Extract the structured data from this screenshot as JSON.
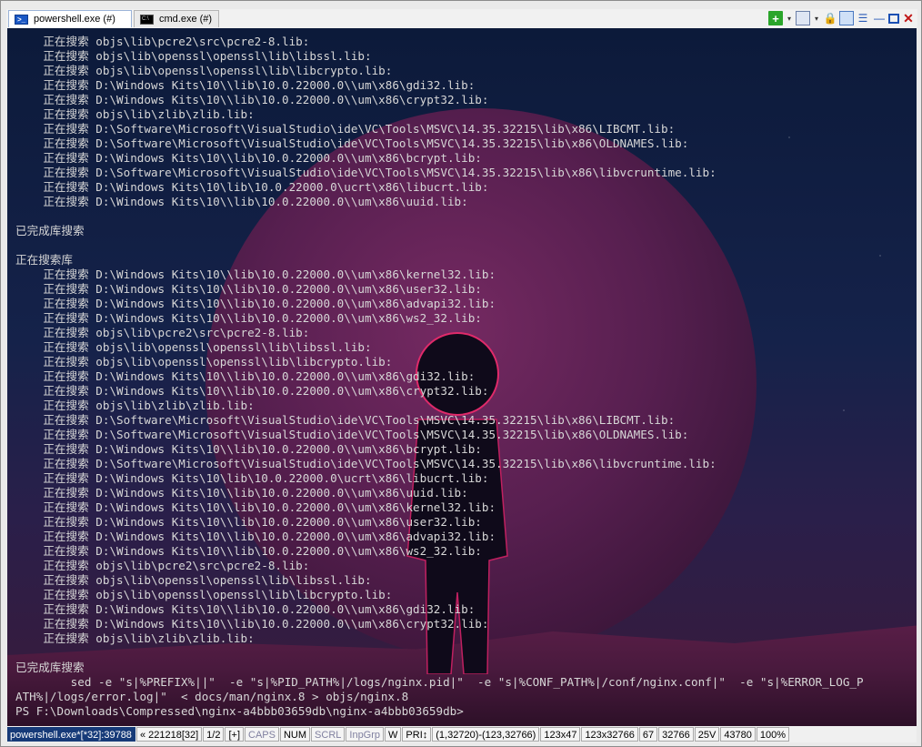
{
  "tabs": [
    {
      "label": "powershell.exe (#)",
      "active": true,
      "icon": "powershell-icon"
    },
    {
      "label": "cmd.exe (#)",
      "active": false,
      "icon": "cmd-icon"
    }
  ],
  "toolbar": {
    "add": "+",
    "dropdown": "▾",
    "view": "▯",
    "lock": "🔒",
    "pane": "◧",
    "list": "☰",
    "minimize": "—",
    "close": "✕"
  },
  "console_lines": [
    "    正在搜索 objs\\lib\\pcre2\\src\\pcre2-8.lib:",
    "    正在搜索 objs\\lib\\openssl\\openssl\\lib\\libssl.lib:",
    "    正在搜索 objs\\lib\\openssl\\openssl\\lib\\libcrypto.lib:",
    "    正在搜索 D:\\Windows Kits\\10\\\\lib\\10.0.22000.0\\\\um\\x86\\gdi32.lib:",
    "    正在搜索 D:\\Windows Kits\\10\\\\lib\\10.0.22000.0\\\\um\\x86\\crypt32.lib:",
    "    正在搜索 objs\\lib\\zlib\\zlib.lib:",
    "    正在搜索 D:\\Software\\Microsoft\\VisualStudio\\ide\\VC\\Tools\\MSVC\\14.35.32215\\lib\\x86\\LIBCMT.lib:",
    "    正在搜索 D:\\Software\\Microsoft\\VisualStudio\\ide\\VC\\Tools\\MSVC\\14.35.32215\\lib\\x86\\OLDNAMES.lib:",
    "    正在搜索 D:\\Windows Kits\\10\\\\lib\\10.0.22000.0\\\\um\\x86\\bcrypt.lib:",
    "    正在搜索 D:\\Software\\Microsoft\\VisualStudio\\ide\\VC\\Tools\\MSVC\\14.35.32215\\lib\\x86\\libvcruntime.lib:",
    "    正在搜索 D:\\Windows Kits\\10\\lib\\10.0.22000.0\\ucrt\\x86\\libucrt.lib:",
    "    正在搜索 D:\\Windows Kits\\10\\\\lib\\10.0.22000.0\\\\um\\x86\\uuid.lib:",
    "",
    "已完成库搜索",
    "",
    "正在搜索库",
    "    正在搜索 D:\\Windows Kits\\10\\\\lib\\10.0.22000.0\\\\um\\x86\\kernel32.lib:",
    "    正在搜索 D:\\Windows Kits\\10\\\\lib\\10.0.22000.0\\\\um\\x86\\user32.lib:",
    "    正在搜索 D:\\Windows Kits\\10\\\\lib\\10.0.22000.0\\\\um\\x86\\advapi32.lib:",
    "    正在搜索 D:\\Windows Kits\\10\\\\lib\\10.0.22000.0\\\\um\\x86\\ws2_32.lib:",
    "    正在搜索 objs\\lib\\pcre2\\src\\pcre2-8.lib:",
    "    正在搜索 objs\\lib\\openssl\\openssl\\lib\\libssl.lib:",
    "    正在搜索 objs\\lib\\openssl\\openssl\\lib\\libcrypto.lib:",
    "    正在搜索 D:\\Windows Kits\\10\\\\lib\\10.0.22000.0\\\\um\\x86\\gdi32.lib:",
    "    正在搜索 D:\\Windows Kits\\10\\\\lib\\10.0.22000.0\\\\um\\x86\\crypt32.lib:",
    "    正在搜索 objs\\lib\\zlib\\zlib.lib:",
    "    正在搜索 D:\\Software\\Microsoft\\VisualStudio\\ide\\VC\\Tools\\MSVC\\14.35.32215\\lib\\x86\\LIBCMT.lib:",
    "    正在搜索 D:\\Software\\Microsoft\\VisualStudio\\ide\\VC\\Tools\\MSVC\\14.35.32215\\lib\\x86\\OLDNAMES.lib:",
    "    正在搜索 D:\\Windows Kits\\10\\\\lib\\10.0.22000.0\\\\um\\x86\\bcrypt.lib:",
    "    正在搜索 D:\\Software\\Microsoft\\VisualStudio\\ide\\VC\\Tools\\MSVC\\14.35.32215\\lib\\x86\\libvcruntime.lib:",
    "    正在搜索 D:\\Windows Kits\\10\\lib\\10.0.22000.0\\ucrt\\x86\\libucrt.lib:",
    "    正在搜索 D:\\Windows Kits\\10\\\\lib\\10.0.22000.0\\\\um\\x86\\uuid.lib:",
    "    正在搜索 D:\\Windows Kits\\10\\\\lib\\10.0.22000.0\\\\um\\x86\\kernel32.lib:",
    "    正在搜索 D:\\Windows Kits\\10\\\\lib\\10.0.22000.0\\\\um\\x86\\user32.lib:",
    "    正在搜索 D:\\Windows Kits\\10\\\\lib\\10.0.22000.0\\\\um\\x86\\advapi32.lib:",
    "    正在搜索 D:\\Windows Kits\\10\\\\lib\\10.0.22000.0\\\\um\\x86\\ws2_32.lib:",
    "    正在搜索 objs\\lib\\pcre2\\src\\pcre2-8.lib:",
    "    正在搜索 objs\\lib\\openssl\\openssl\\lib\\libssl.lib:",
    "    正在搜索 objs\\lib\\openssl\\openssl\\lib\\libcrypto.lib:",
    "    正在搜索 D:\\Windows Kits\\10\\\\lib\\10.0.22000.0\\\\um\\x86\\gdi32.lib:",
    "    正在搜索 D:\\Windows Kits\\10\\\\lib\\10.0.22000.0\\\\um\\x86\\crypt32.lib:",
    "    正在搜索 objs\\lib\\zlib\\zlib.lib:",
    "",
    "已完成库搜索",
    "        sed -e \"s|%PREFIX%||\"  -e \"s|%PID_PATH%|/logs/nginx.pid|\"  -e \"s|%CONF_PATH%|/conf/nginx.conf|\"  -e \"s|%ERROR_LOG_P",
    "ATH%|/logs/error.log|\"  < docs/man/nginx.8 > objs/nginx.8",
    "PS F:\\Downloads\\Compressed\\nginx-a4bbb03659db\\nginx-a4bbb03659db>"
  ],
  "statusbar": [
    {
      "text": "powershell.exe*[*32]:39788",
      "style": "first"
    },
    {
      "text": "« 221218[32]",
      "style": ""
    },
    {
      "text": "1/2",
      "style": ""
    },
    {
      "text": "[+]",
      "style": ""
    },
    {
      "text": "CAPS",
      "style": "dim"
    },
    {
      "text": "NUM",
      "style": ""
    },
    {
      "text": "SCRL",
      "style": "dim"
    },
    {
      "text": "InpGrp",
      "style": "dim"
    },
    {
      "text": "W",
      "style": ""
    },
    {
      "text": "PRI↕",
      "style": ""
    },
    {
      "text": "(1,32720)-(123,32766)",
      "style": ""
    },
    {
      "text": "123x47",
      "style": ""
    },
    {
      "text": "123x32766",
      "style": ""
    },
    {
      "text": "67",
      "style": ""
    },
    {
      "text": "32766",
      "style": ""
    },
    {
      "text": "25V",
      "style": ""
    },
    {
      "text": "43780",
      "style": ""
    },
    {
      "text": "100%",
      "style": ""
    }
  ]
}
